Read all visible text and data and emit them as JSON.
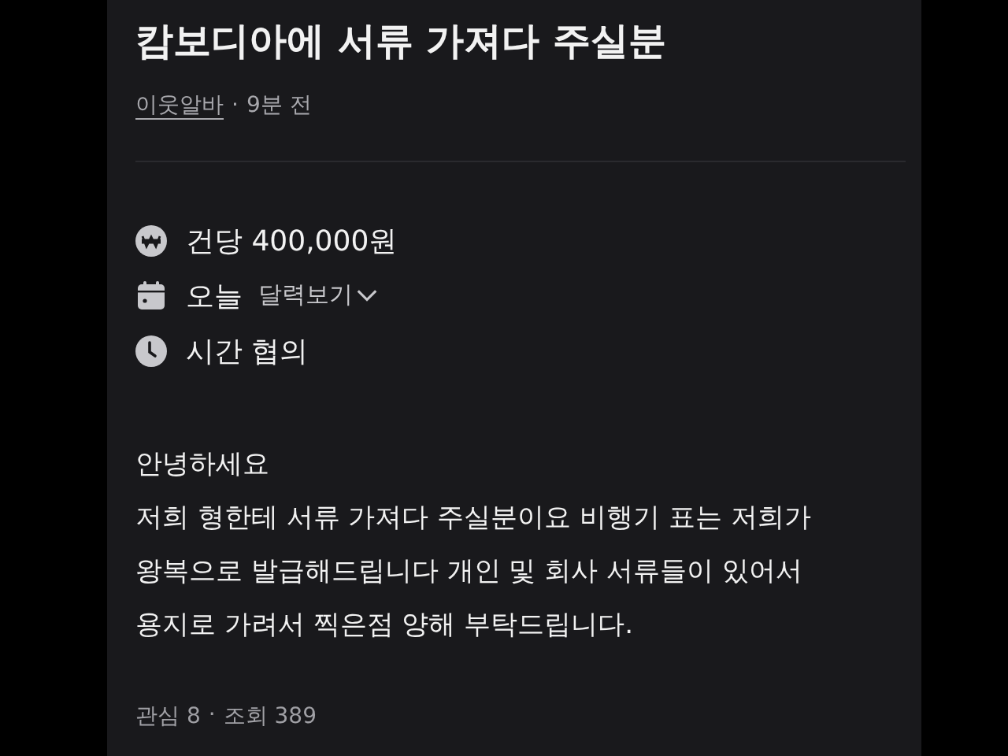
{
  "title": "캄보디아에 서류 가져다 주실분",
  "meta": {
    "author": "이웃알바",
    "separator": "·",
    "time": "9분 전"
  },
  "info": [
    {
      "kind": "price",
      "text": "건당 400,000원"
    },
    {
      "kind": "date",
      "text": "오늘",
      "link": "달력보기"
    },
    {
      "kind": "time",
      "text": "시간 협의"
    }
  ],
  "body": [
    "안녕하세요",
    "저희 형한테 서류 가져다 주실분이요 비행기 표는 저희가",
    "왕복으로 발급해드립니다 개인 및 회사 서류들이 있어서",
    "용지로 가려서 찍은점 양해 부탁드립니다."
  ],
  "stats": {
    "interest": "관심 8",
    "separator": "·",
    "views": "조회 389"
  }
}
